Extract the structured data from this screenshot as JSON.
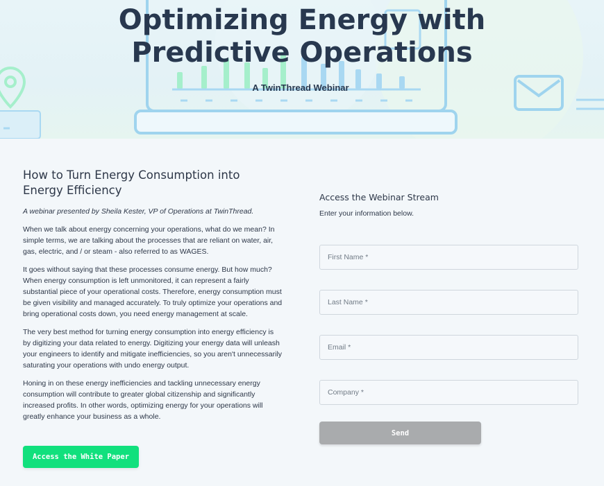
{
  "hero": {
    "title": "Optimizing Energy with Predictive Operations",
    "subtitle": "A TwinThread Webinar",
    "colors": {
      "title": "#28384f",
      "illustration_blue": "#8ecbe8",
      "illustration_green": "#8eedc1"
    },
    "icons": [
      "laptop-illustration",
      "bar-chart-illustration",
      "map-pin-icon",
      "envelope-icon",
      "user-card-icon"
    ]
  },
  "article": {
    "heading": "How to Turn Energy Consumption into Energy Efficiency",
    "byline": "A webinar presented by Sheila Kester, VP of Operations at TwinThread.",
    "paragraphs": [
      "When we talk about energy concerning your operations, what do we mean? In simple terms, we are talking about the processes that are reliant on water, air, gas, electric, and / or steam - also referred to as WAGES.",
      "It goes without saying that these processes consume energy. But how much? When energy consumption is left unmonitored, it can represent a fairly substantial piece of your operational costs. Therefore, energy consumption must be given visibility and managed accurately. To truly optimize your operations and bring operational costs down, you need energy management at scale.",
      "The very best method for turning energy consumption into energy efficiency is by digitizing your data related to energy. Digitizing your energy data will unleash your engineers to identify and mitigate inefficiencies, so you aren't unnecessarily saturating your operations with undo energy output.",
      "Honing in on these energy inefficiencies and tackling unnecessary energy consumption will contribute to greater global citizenship and significantly increased profits. In other words, optimizing energy for your operations will greatly enhance your business as a whole."
    ],
    "cta_label": "Access the White Paper",
    "cta_color": "#11e07d"
  },
  "form": {
    "title": "Access the Webinar Stream",
    "subtitle": "Enter your information below.",
    "fields": [
      {
        "name": "first-name",
        "placeholder": "First Name *",
        "value": ""
      },
      {
        "name": "last-name",
        "placeholder": "Last Name *",
        "value": ""
      },
      {
        "name": "email",
        "placeholder": "Email *",
        "value": ""
      },
      {
        "name": "company",
        "placeholder": "Company *",
        "value": ""
      }
    ],
    "submit_label": "Send",
    "submit_color": "#a9abad"
  }
}
